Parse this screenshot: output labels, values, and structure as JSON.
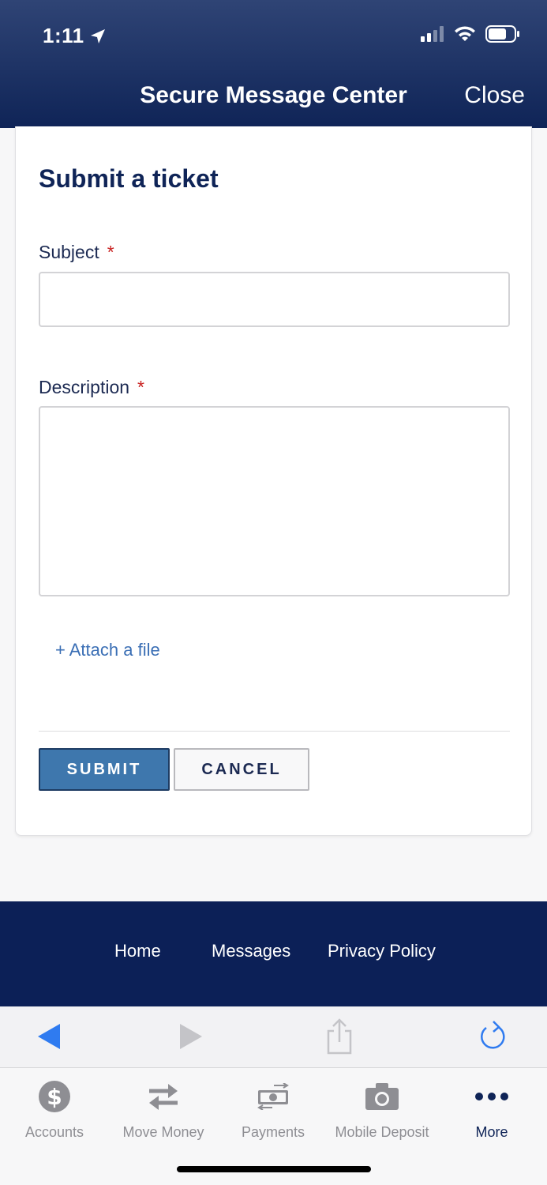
{
  "status_bar": {
    "time": "1:11"
  },
  "header": {
    "title": "Secure Message Center",
    "close_label": "Close"
  },
  "form": {
    "title": "Submit a ticket",
    "subject": {
      "label": "Subject",
      "required_mark": "*",
      "value": ""
    },
    "description": {
      "label": "Description",
      "required_mark": "*",
      "value": ""
    },
    "attach_label": "+ Attach a file",
    "submit_label": "SUBMIT",
    "cancel_label": "CANCEL"
  },
  "footer": {
    "links": [
      "Home",
      "Messages",
      "Privacy Policy"
    ]
  },
  "browser_bar": {
    "icons": [
      "back-arrow-icon",
      "forward-arrow-icon",
      "share-icon",
      "reload-icon"
    ]
  },
  "tabbar": {
    "items": [
      {
        "label": "Accounts",
        "icon": "dollar-circle-icon",
        "active": false
      },
      {
        "label": "Move Money",
        "icon": "transfer-arrows-icon",
        "active": false
      },
      {
        "label": "Payments",
        "icon": "bill-icon",
        "active": false
      },
      {
        "label": "Mobile Deposit",
        "icon": "camera-icon",
        "active": false
      },
      {
        "label": "More",
        "icon": "more-dots-icon",
        "active": true
      }
    ]
  },
  "colors": {
    "header": "#0f2457",
    "accent": "#3e77ad",
    "required": "#c8201f",
    "link": "#3b6fb5",
    "ios_blue": "#2f7bf0"
  }
}
